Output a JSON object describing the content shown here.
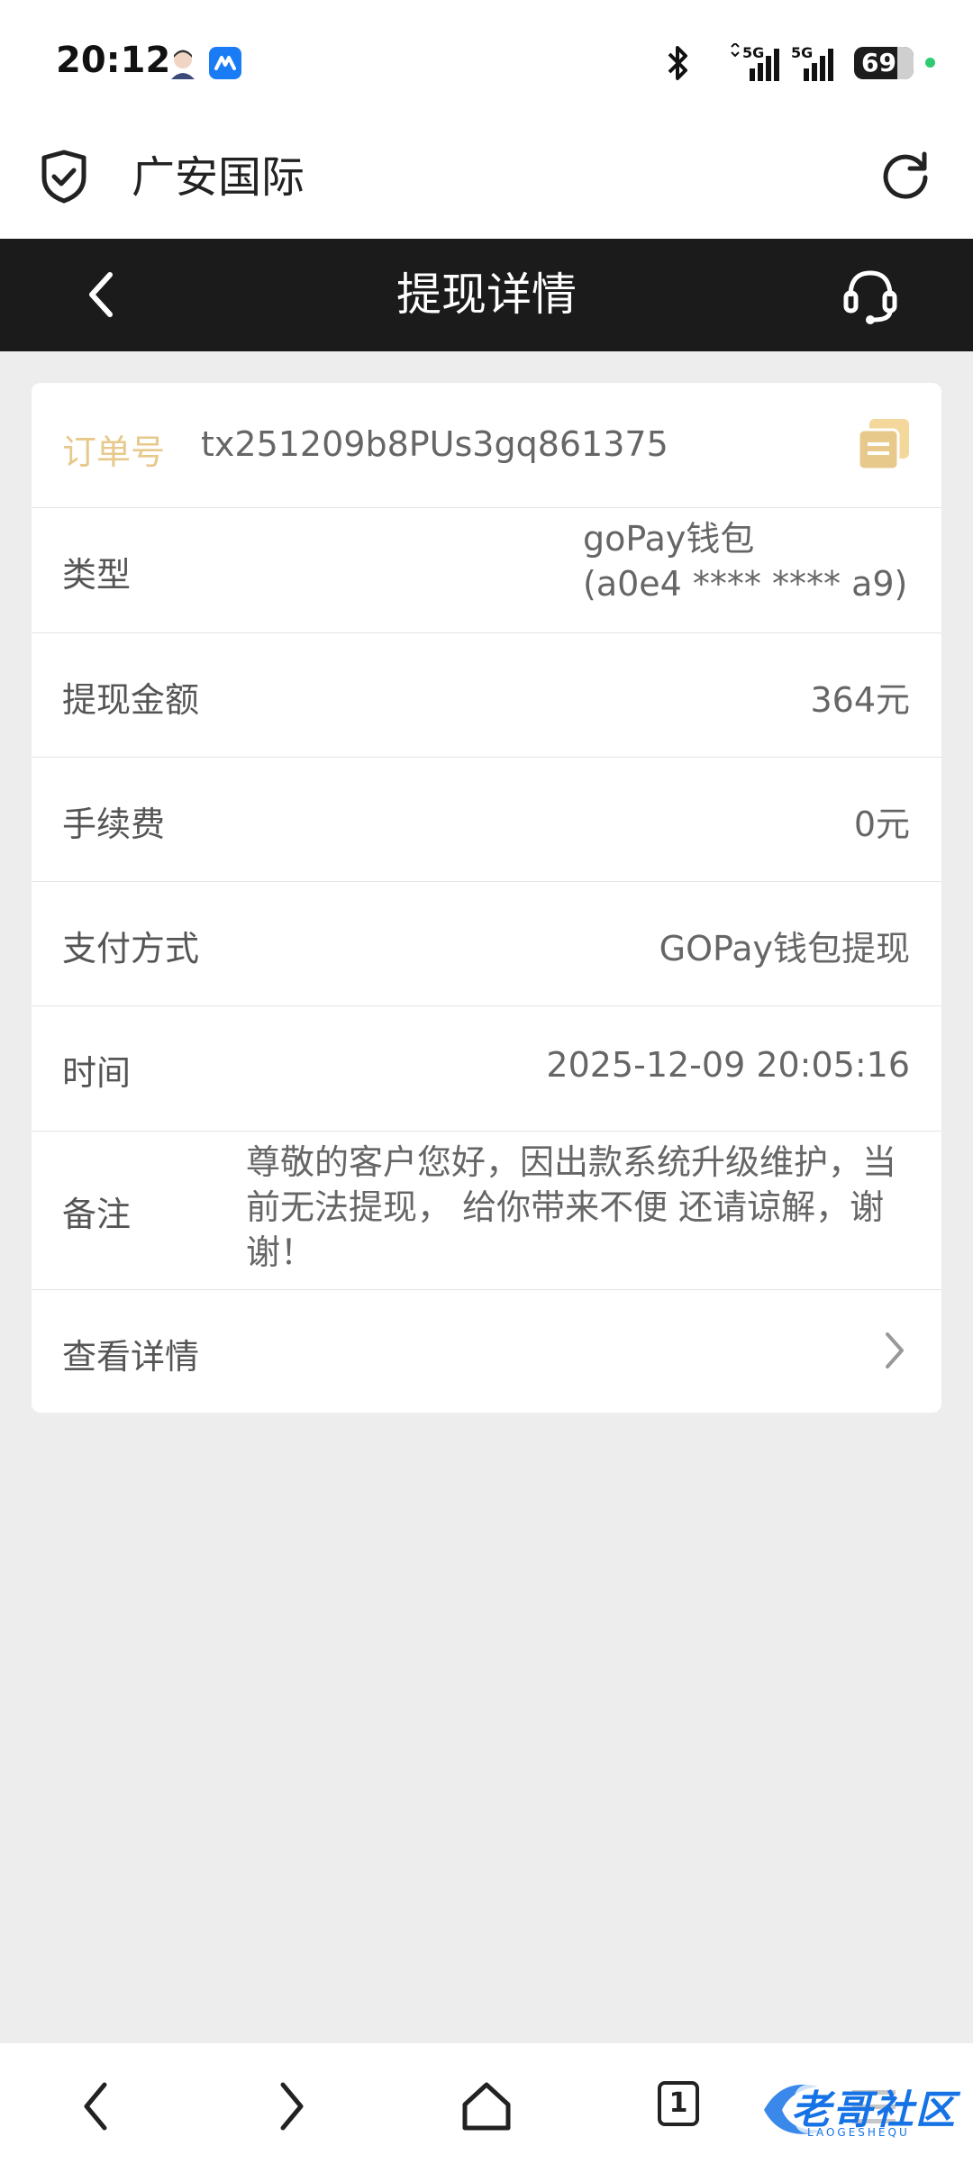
{
  "status_bar": {
    "time": "20:12",
    "network1": "5G",
    "network2": "5G",
    "battery": "69"
  },
  "browser": {
    "site_title": "广安国际"
  },
  "nav": {
    "title": "提现详情"
  },
  "details": {
    "order_label": "订单号",
    "order_value": "tx251209b8PUs3gq861375",
    "type_label": "类型",
    "type_value_line1": "goPay钱包",
    "type_value_line2": "(a0e4 **** **** a9)",
    "amount_label": "提现金额",
    "amount_value": "364元",
    "fee_label": "手续费",
    "fee_value": "0元",
    "method_label": "支付方式",
    "method_value": "GOPay钱包提现",
    "time_label": "时间",
    "time_value": "2025-12-09 20:05:16",
    "remark_label": "备注",
    "remark_value": "尊敬的客户您好，因出款系统升级维护，当前无法提现， 给你带来不便 还请谅解，谢谢！",
    "view_details_label": "查看详情"
  },
  "bottom_bar": {
    "tab_count": "1",
    "watermark_text": "老哥社区",
    "watermark_sub": "LAOGESHEQU"
  },
  "colors": {
    "nav_bg": "#1b1b1b",
    "accent_gold": "#e8c98c",
    "page_bg": "#ededed"
  }
}
